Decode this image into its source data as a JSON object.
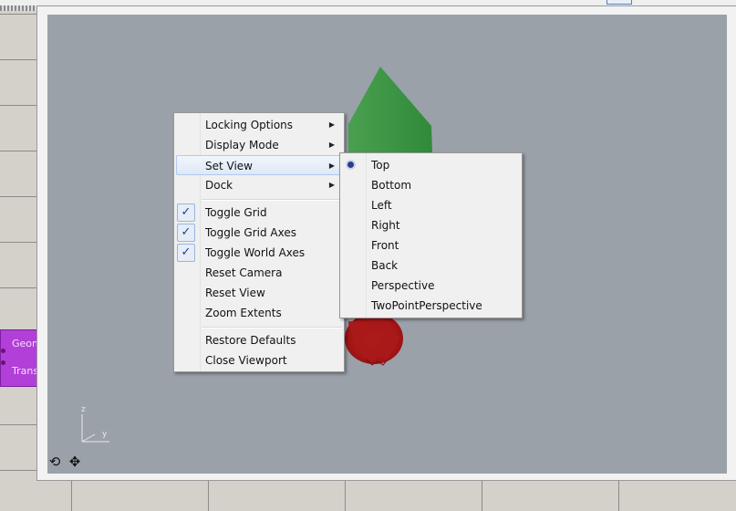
{
  "main_menu": {
    "items": [
      {
        "label": "Locking Options",
        "submenu": true
      },
      {
        "label": "Display Mode",
        "submenu": true
      },
      {
        "label": "Set View",
        "submenu": true,
        "highlighted": true
      },
      {
        "label": "Dock",
        "submenu": true
      },
      {
        "label": "Toggle Grid",
        "checked": true
      },
      {
        "label": "Toggle Grid Axes",
        "checked": true
      },
      {
        "label": "Toggle World Axes",
        "checked": true
      },
      {
        "label": "Reset Camera"
      },
      {
        "label": "Reset View"
      },
      {
        "label": "Zoom Extents"
      },
      {
        "label": "Restore Defaults"
      },
      {
        "label": "Close Viewport"
      }
    ]
  },
  "set_view_menu": {
    "items": [
      {
        "label": "Top",
        "selected": true
      },
      {
        "label": "Bottom"
      },
      {
        "label": "Left"
      },
      {
        "label": "Right"
      },
      {
        "label": "Front"
      },
      {
        "label": "Back"
      },
      {
        "label": "Perspective"
      },
      {
        "label": "TwoPointPerspective"
      }
    ]
  },
  "component": {
    "input_label": "Geom",
    "output_label": "Trans"
  },
  "axes": {
    "z_label": "z",
    "y_label": "y"
  },
  "icons": {
    "submenu_arrow": "triangle-right-icon",
    "check": "checkmark-icon",
    "radio": "radio-dot-icon",
    "rotate": "rotate-icon",
    "pan": "pan-icon"
  },
  "colors": {
    "viewport_bg": "#9aa1a9",
    "green_shape": "#3e9a45",
    "red_shape": "#b01818",
    "component": "#b23fd8",
    "menu_highlight": "#dde8f6"
  }
}
